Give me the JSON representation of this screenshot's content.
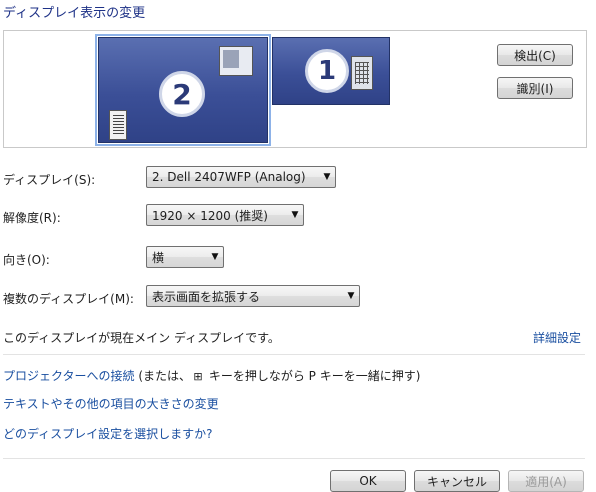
{
  "title": "ディスプレイ表示の変更",
  "monitors": [
    {
      "number": "2",
      "selected": true
    },
    {
      "number": "1",
      "selected": false
    }
  ],
  "buttons": {
    "detect": "検出(C)",
    "identify": "識別(I)",
    "ok": "OK",
    "cancel": "キャンセル",
    "apply": "適用(A)"
  },
  "settings": {
    "display": {
      "label": "ディスプレイ(S):",
      "value": "2. Dell 2407WFP (Analog)"
    },
    "resolution": {
      "label": "解像度(R):",
      "value": "1920 × 1200 (推奨)"
    },
    "orientation": {
      "label": "向き(O):",
      "value": "横"
    },
    "multiple": {
      "label": "複数のディスプレイ(M):",
      "value": "表示画面を拡張する"
    }
  },
  "info_text": "このディスプレイが現在メイン ディスプレイです。",
  "advanced_link": "詳細設定",
  "links": {
    "projector": "プロジェクターへの接続",
    "projector_hint_pre": " (または、",
    "projector_hint_post": " キーを押しながら P キーを一緒に押す)",
    "text_size": "テキストやその他の項目の大きさの変更",
    "which_settings": "どのディスプレイ設定を選択しますか?"
  },
  "icons": {
    "windows_key": "windows-logo-icon",
    "dropdown": "chevron-down-icon"
  }
}
